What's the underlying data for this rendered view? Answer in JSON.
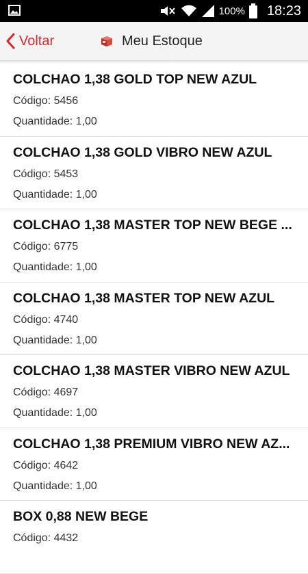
{
  "status_bar": {
    "battery_percent": "100%",
    "time": "18:23",
    "icons": [
      "gallery-icon",
      "mute-icon",
      "wifi-icon",
      "signal-icon",
      "battery-icon"
    ]
  },
  "header": {
    "back_label": "Voltar",
    "title": "Meu Estoque",
    "accent_color": "#e0252a"
  },
  "list": {
    "code_prefix": "Código:",
    "qty_prefix": "Quantidade:",
    "items": [
      {
        "name": "COLCHAO 1,38 GOLD TOP NEW AZUL",
        "code_label": "Código: 5456",
        "qty_label": "Quantidade: 1,00"
      },
      {
        "name": "COLCHAO 1,38 GOLD VIBRO NEW AZUL",
        "code_label": "Código: 5453",
        "qty_label": "Quantidade: 1,00"
      },
      {
        "name": "COLCHAO 1,38 MASTER TOP NEW BEGE ...",
        "code_label": "Código: 6775",
        "qty_label": "Quantidade: 1,00"
      },
      {
        "name": "COLCHAO 1,38 MASTER TOP NEW AZUL",
        "code_label": "Código: 4740",
        "qty_label": "Quantidade: 1,00"
      },
      {
        "name": "COLCHAO 1,38 MASTER VIBRO NEW AZUL",
        "code_label": "Código: 4697",
        "qty_label": "Quantidade: 1,00"
      },
      {
        "name": "COLCHAO 1,38 PREMIUM VIBRO NEW AZ...",
        "code_label": "Código: 4642",
        "qty_label": "Quantidade: 1,00"
      },
      {
        "name": "BOX 0,88 NEW BEGE",
        "code_label": "Código: 4432",
        "qty_label": ""
      }
    ]
  }
}
